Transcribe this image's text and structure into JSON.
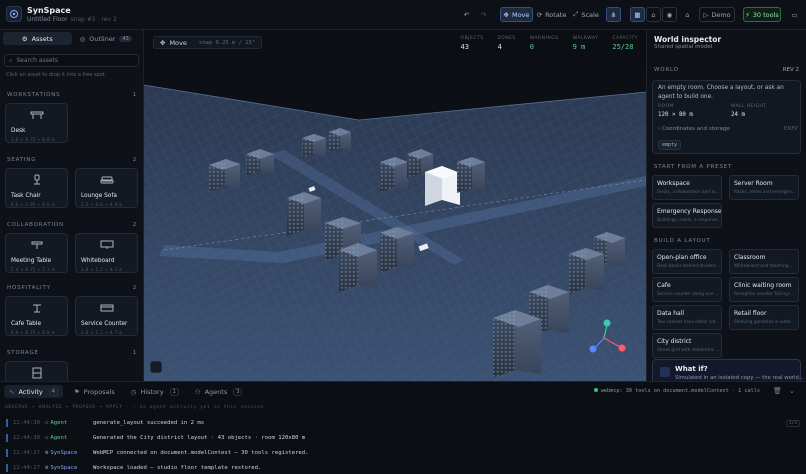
{
  "app": {
    "name": "SynSpace",
    "floor": "Untitled Floor",
    "meta": "snap #5 · rev 2"
  },
  "toolbar": {
    "move": "Move",
    "rotate": "Rotate",
    "scale": "Scale",
    "demo": "Demo",
    "tools": "30 tools"
  },
  "left": {
    "tab_assets": "Assets",
    "tab_outliner": "Outliner",
    "outliner_count": "43",
    "search_placeholder": "Search assets",
    "hint": "Click an asset to drop it into a free spot.",
    "sections": [
      {
        "name": "WORKSTATIONS",
        "count": "1"
      },
      {
        "name": "SEATING",
        "count": "2"
      },
      {
        "name": "COLLABORATION",
        "count": "2"
      },
      {
        "name": "HOSPITALITY",
        "count": "2"
      },
      {
        "name": "STORAGE",
        "count": "1"
      }
    ],
    "assets": [
      {
        "name": "Desk",
        "dims": "1.6 × 0.75 × 0.8 m"
      },
      {
        "name": "Task Chair",
        "dims": "0.6 × 1.05 × 0.6 m"
      },
      {
        "name": "Lounge Sofa",
        "dims": "2.2 × 0.8 × 0.9 m"
      },
      {
        "name": "Meeting Table",
        "dims": "2.4 × 0.75 × 1.2 m"
      },
      {
        "name": "Whiteboard",
        "dims": "1.8 × 1.2 × 0.1 m"
      },
      {
        "name": "Cafe Table",
        "dims": "0.8 × 0.75 × 0.8 m"
      },
      {
        "name": "Service Counter",
        "dims": "3.0 × 1.1 × 0.7 m"
      }
    ]
  },
  "viewport": {
    "mode": "Move",
    "snap": "snap 0.25 m / 15°",
    "stats": [
      {
        "label": "OBJECTS",
        "value": "43",
        "color": "#d9e0e8"
      },
      {
        "label": "ZONES",
        "value": "4",
        "color": "#d9e0e8"
      },
      {
        "label": "WARNINGS",
        "value": "0",
        "color": "#4fd08a"
      },
      {
        "label": "WALKWAY",
        "value": "9 m",
        "color": "#4fd08a"
      },
      {
        "label": "CAPACITY",
        "value": "25/28",
        "color": "#4fd08a"
      }
    ]
  },
  "inspector": {
    "title": "World inspector",
    "subtitle": "Shared spatial model",
    "world_label": "WORLD",
    "rev": "REV 2",
    "description": "An empty room. Choose a layout, or ask an agent to build one.",
    "room_label": "ROOM",
    "room_value": "120 × 80 m",
    "wall_label": "WALL HEIGHT",
    "wall_value": "24 m",
    "coords_label": "Coordinates and storage",
    "coords_meta": "ENFP",
    "empty_tag": "empty",
    "presets_label": "START FROM A PRESET",
    "presets": [
      {
        "title": "Workspace",
        "desc": "Desks, collaboration and lo..."
      },
      {
        "title": "Server Room",
        "desc": "Racks, aisles and emergen..."
      },
      {
        "title": "Emergency Response",
        "desc": "Buildings, roads, a response..."
      }
    ],
    "build_label": "BUILD A LAYOUT",
    "layouts": [
      {
        "title": "Open-plan office",
        "desc": "Desk banks behind dividers..."
      },
      {
        "title": "Classroom",
        "desc": "Whiteboard and teaching..."
      },
      {
        "title": "Cafe",
        "desc": "Service counter along one ..."
      },
      {
        "title": "Clinic waiting room",
        "desc": "Reception counter facing r..."
      },
      {
        "title": "Data hall",
        "desc": "Two cabinet rows either sid..."
      },
      {
        "title": "Retail floor",
        "desc": "Shelving gondolas in wate..."
      },
      {
        "title": "City district",
        "desc": "Street grid with residential ..."
      }
    ],
    "whatif_title": "What if?",
    "whatif_desc": "Simulated in an isolated copy — the real world..."
  },
  "bottom": {
    "tabs": [
      {
        "label": "Activity",
        "count": "4"
      },
      {
        "label": "Proposals",
        "count": ""
      },
      {
        "label": "History",
        "count": "1"
      },
      {
        "label": "Agents",
        "count": "3"
      }
    ],
    "webmcp": "webmcp: 30 tools on document.modelContext · 1 calls",
    "pipeline": "OBSERVE → ANALYZE → PROPOSE → APPLY · — no agent activity yet in this session.",
    "pager": "1/3",
    "logs": [
      {
        "time": "12:44:30",
        "who": "Agent",
        "kind": "agent",
        "msg": "generate_layout succeeded in 2 ms"
      },
      {
        "time": "12:44:30",
        "who": "Agent",
        "kind": "agent",
        "msg": "Generated the City district layout · 43 objects · room 120x80 m"
      },
      {
        "time": "12:44:27",
        "who": "SynSpace",
        "kind": "sys",
        "msg": "WebMCP connected on document.modelContext — 30 tools registered."
      },
      {
        "time": "12:44:27",
        "who": "SynSpace",
        "kind": "sys",
        "msg": "Workspace loaded — studio floor template restored."
      }
    ]
  }
}
